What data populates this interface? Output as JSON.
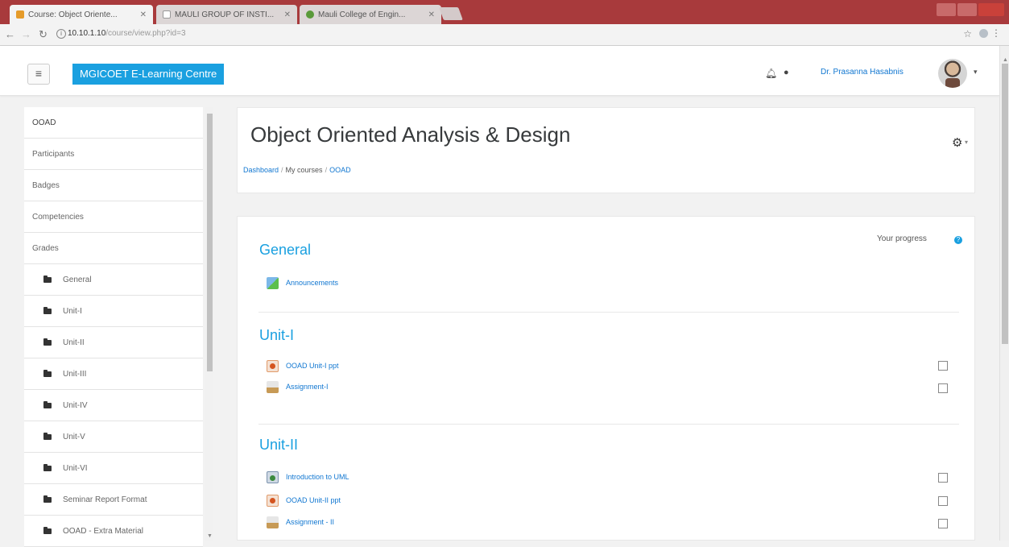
{
  "browser": {
    "tabs": [
      {
        "title": "Course: Object Oriente..."
      },
      {
        "title": "MAULI GROUP OF INSTI..."
      },
      {
        "title": "Mauli College of Engin..."
      }
    ],
    "url_host": "10.10.1.10",
    "url_path": "/course/view.php?id=3",
    "icons": {
      "back": "back-arrow-icon",
      "forward": "forward-arrow-icon",
      "reload": "reload-icon",
      "bookmark": "star-icon",
      "menu": "kebab-menu-icon"
    }
  },
  "navbar": {
    "brand": "MGICOET E-Learning Centre",
    "user_name": "Dr. Prasanna Hasabnis"
  },
  "drawer": {
    "items": [
      {
        "label": "OOAD"
      },
      {
        "label": "Participants"
      },
      {
        "label": "Badges"
      },
      {
        "label": "Competencies"
      },
      {
        "label": "Grades"
      }
    ],
    "sections": [
      {
        "label": "General"
      },
      {
        "label": "Unit-I"
      },
      {
        "label": "Unit-II"
      },
      {
        "label": "Unit-III"
      },
      {
        "label": "Unit-IV"
      },
      {
        "label": "Unit-V"
      },
      {
        "label": "Unit-VI"
      },
      {
        "label": "Seminar Report Format"
      },
      {
        "label": "OOAD - Extra Material"
      }
    ]
  },
  "header": {
    "title": "Object Oriented Analysis & Design",
    "breadcrumb": [
      "Dashboard",
      "My courses",
      "OOAD"
    ],
    "separator": "/"
  },
  "main": {
    "progress_label": "Your progress",
    "sections": [
      {
        "title": "General",
        "activities": [
          {
            "label": "Announcements",
            "icon": "forum-icon",
            "checkbox": false
          }
        ]
      },
      {
        "title": "Unit-I",
        "activities": [
          {
            "label": "OOAD Unit-I ppt",
            "icon": "ppt-icon",
            "checkbox": true
          },
          {
            "label": "Assignment-I",
            "icon": "assignment-icon",
            "checkbox": true
          }
        ]
      },
      {
        "title": "Unit-II",
        "activities": [
          {
            "label": "Introduction to UML",
            "icon": "url-icon",
            "checkbox": true
          },
          {
            "label": "OOAD Unit-II ppt",
            "icon": "ppt-icon",
            "checkbox": true
          },
          {
            "label": "Assignment - II",
            "icon": "assignment-icon",
            "checkbox": true
          }
        ]
      }
    ]
  },
  "colors": {
    "accent": "#1aa0e0",
    "link": "#1177d1",
    "chrome": "#a83a3c"
  }
}
